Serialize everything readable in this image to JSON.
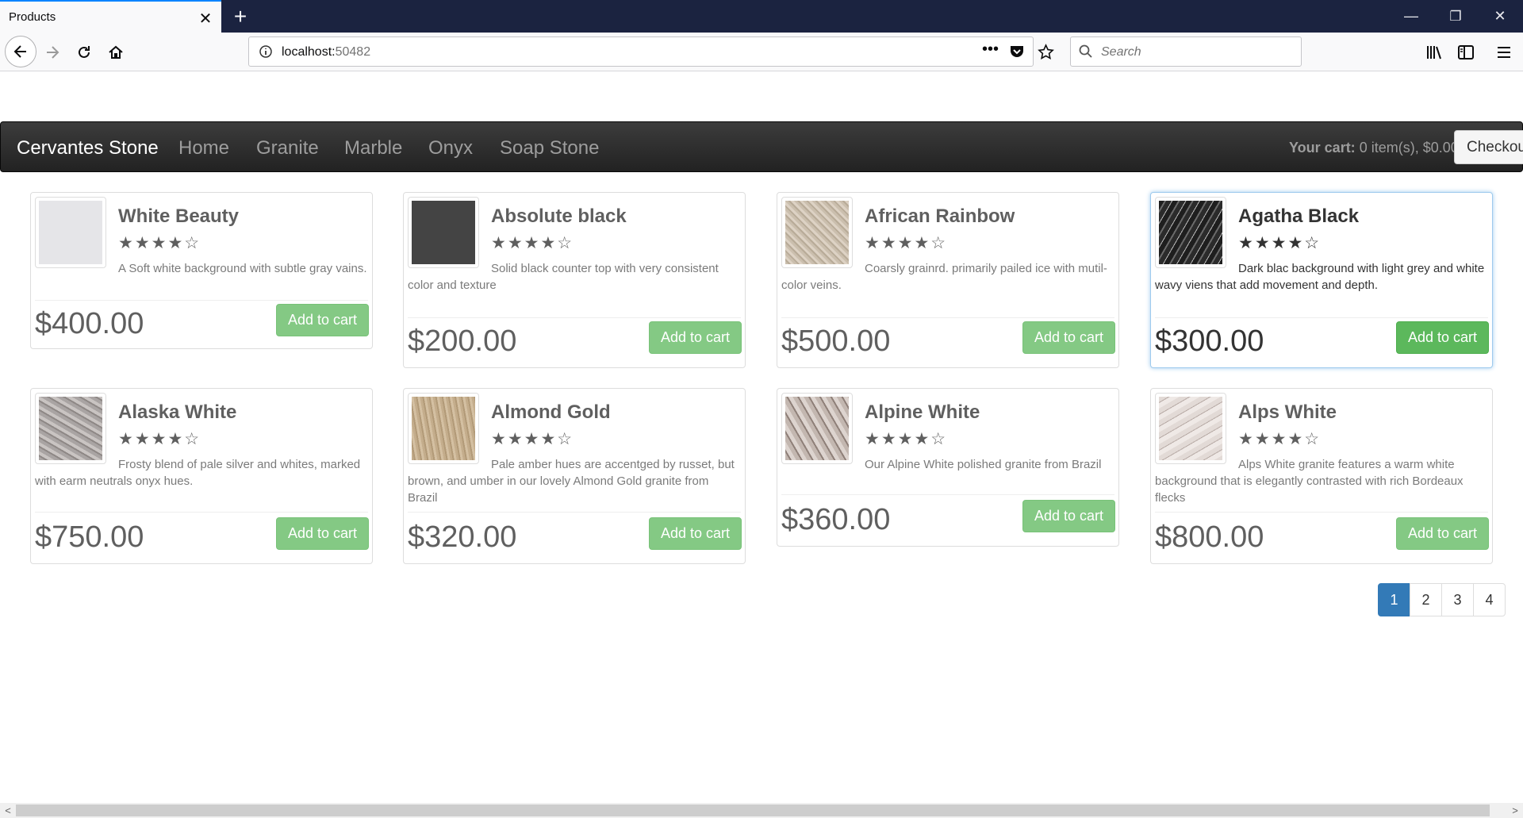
{
  "browser": {
    "tab_title": "Products",
    "tab_close": "✕",
    "new_tab": "+",
    "url_host": "localhost:",
    "url_port": "50482",
    "search_placeholder": "Search",
    "window_minimize": "—",
    "window_restore": "❐",
    "window_close": "✕"
  },
  "site": {
    "brand": "Cervantes Stone",
    "nav": [
      "Home",
      "Granite",
      "Marble",
      "Onyx",
      "Soap Stone"
    ],
    "cart_label": "Your cart:",
    "cart_value": "0 item(s), $0.00",
    "checkout": "Checkout"
  },
  "products": [
    {
      "name": "White Beauty",
      "rating": 4,
      "stars": "★★★★☆",
      "desc": "A Soft white background with subtle gray vains.",
      "price": "$400.00",
      "button": "Add to cart",
      "swatch": "#e5e5e8"
    },
    {
      "name": "Absolute black",
      "rating": 4,
      "stars": "★★★★☆",
      "desc": "Solid black counter top with very consistent color and texture",
      "price": "$200.00",
      "button": "Add to cart",
      "swatch": "#444444"
    },
    {
      "name": "African Rainbow",
      "rating": 4,
      "stars": "★★★★☆",
      "desc": "Coarsly grainrd. primarily pailed ice with mutil-color veins.",
      "price": "$500.00",
      "button": "Add to cart",
      "swatch": "#cbbfae"
    },
    {
      "name": "Agatha Black",
      "rating": 4,
      "stars": "★★★★☆",
      "desc": "Dark blac background with light grey and white wavy viens that add movement and depth.",
      "price": "$300.00",
      "button": "Add to cart",
      "swatch": "#2b2b2b"
    },
    {
      "name": "Alaska White",
      "rating": 4,
      "stars": "★★★★☆",
      "desc": "Frosty blend of pale silver and whites, marked with earm neutrals onyx hues.",
      "price": "$750.00",
      "button": "Add to cart",
      "swatch": "#a9a4a3"
    },
    {
      "name": "Almond Gold",
      "rating": 4,
      "stars": "★★★★☆",
      "desc": "Pale amber hues are accentged by russet, but brown, and umber in our lovely Almond Gold granite from Brazil",
      "price": "$320.00",
      "button": "Add to cart",
      "swatch": "#c4ad8c"
    },
    {
      "name": "Alpine White",
      "rating": 4,
      "stars": "★★★★☆",
      "desc": "Our Alpine White polished granite from Brazil",
      "price": "$360.00",
      "button": "Add to cart",
      "swatch": "#c3b7b0"
    },
    {
      "name": "Alps White",
      "rating": 4,
      "stars": "★★★★☆",
      "desc": "Alps White granite features a warm white background that is elegantly contrasted with rich Bordeaux flecks",
      "price": "$800.00",
      "button": "Add to cart",
      "swatch": "#e2dad6"
    }
  ],
  "pagination": {
    "pages": [
      "1",
      "2",
      "3",
      "4"
    ],
    "current": "1"
  },
  "colors": {
    "button": "#5cb85c",
    "active_page": "#337ab7",
    "navbar": "#222222"
  }
}
